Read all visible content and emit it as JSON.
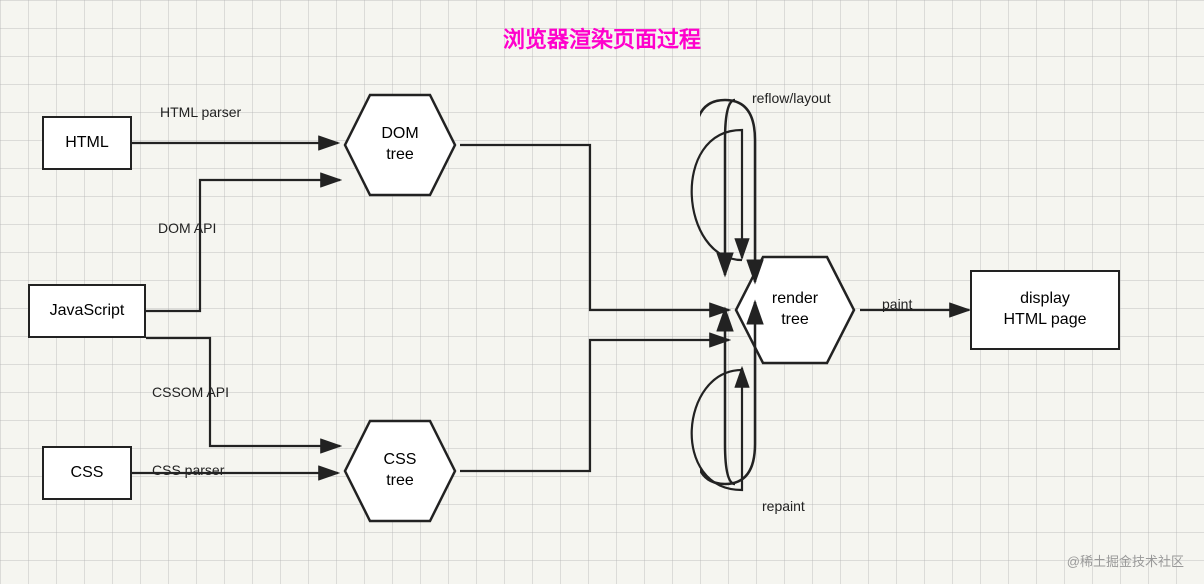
{
  "title": "浏览器渲染页面过程",
  "nodes": {
    "html": {
      "label": "HTML"
    },
    "javascript": {
      "label": "JavaScript"
    },
    "css": {
      "label": "CSS"
    },
    "dom_tree": {
      "label": "DOM\ntree"
    },
    "css_tree": {
      "label": "CSS\ntree"
    },
    "render_tree": {
      "label": "render\ntree"
    },
    "display": {
      "label": "display\nHTML page"
    }
  },
  "labels": {
    "html_parser": "HTML parser",
    "dom_api": "DOM API",
    "cssom_api": "CSSOM API",
    "css_parser": "CSS parser",
    "reflow": "reflow/layout",
    "repaint": "repaint",
    "paint": "paint"
  },
  "watermark": "@稀土掘金技术社区"
}
